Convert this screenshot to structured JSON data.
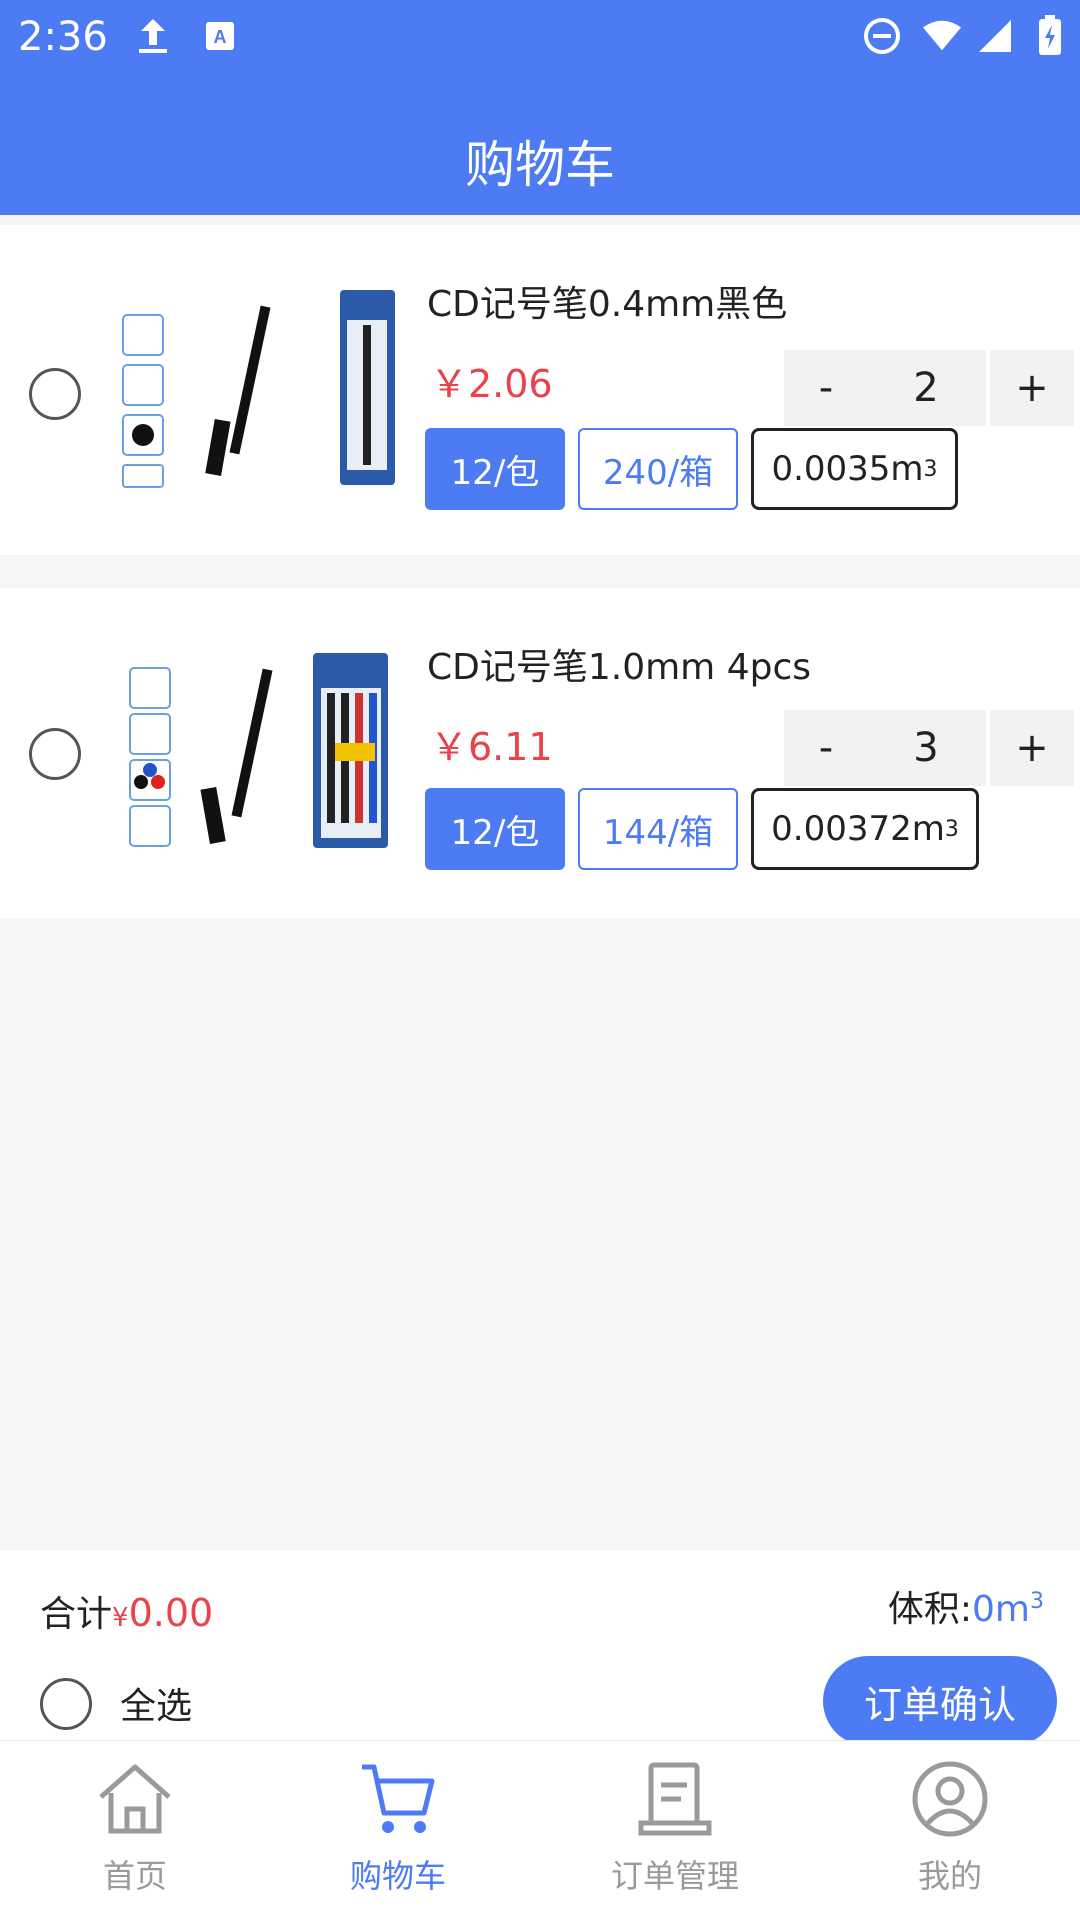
{
  "status_bar": {
    "time": "2:36"
  },
  "header": {
    "title": "购物车"
  },
  "items": [
    {
      "name": "CD记号笔0.4mm黑色",
      "price": "￥2.06",
      "quantity": "2",
      "qty_minus": "-",
      "qty_plus": "+",
      "pack_unit": "12/包",
      "box_unit": "240/箱",
      "volume": "0.0035m",
      "volume_sup": "3"
    },
    {
      "name": "CD记号笔1.0mm 4pcs",
      "price": "￥6.11",
      "quantity": "3",
      "qty_minus": "-",
      "qty_plus": "+",
      "pack_unit": "12/包",
      "box_unit": "144/箱",
      "volume": "0.00372m",
      "volume_sup": "3"
    }
  ],
  "summary": {
    "total_label": "合计",
    "total_currency": "¥",
    "total_value": "0.00",
    "volume_label": "体积:",
    "volume_value": "0m",
    "volume_sup": "3",
    "select_all_label": "全选",
    "confirm_label": "订单确认"
  },
  "tabs": [
    {
      "label": "首页",
      "icon": "home-icon"
    },
    {
      "label": "购物车",
      "icon": "cart-icon",
      "active": true
    },
    {
      "label": "订单管理",
      "icon": "order-icon"
    },
    {
      "label": "我的",
      "icon": "user-icon"
    }
  ],
  "colors": {
    "primary": "#4c7bf3",
    "price": "#e8434b",
    "background": "#f6f6f8"
  }
}
